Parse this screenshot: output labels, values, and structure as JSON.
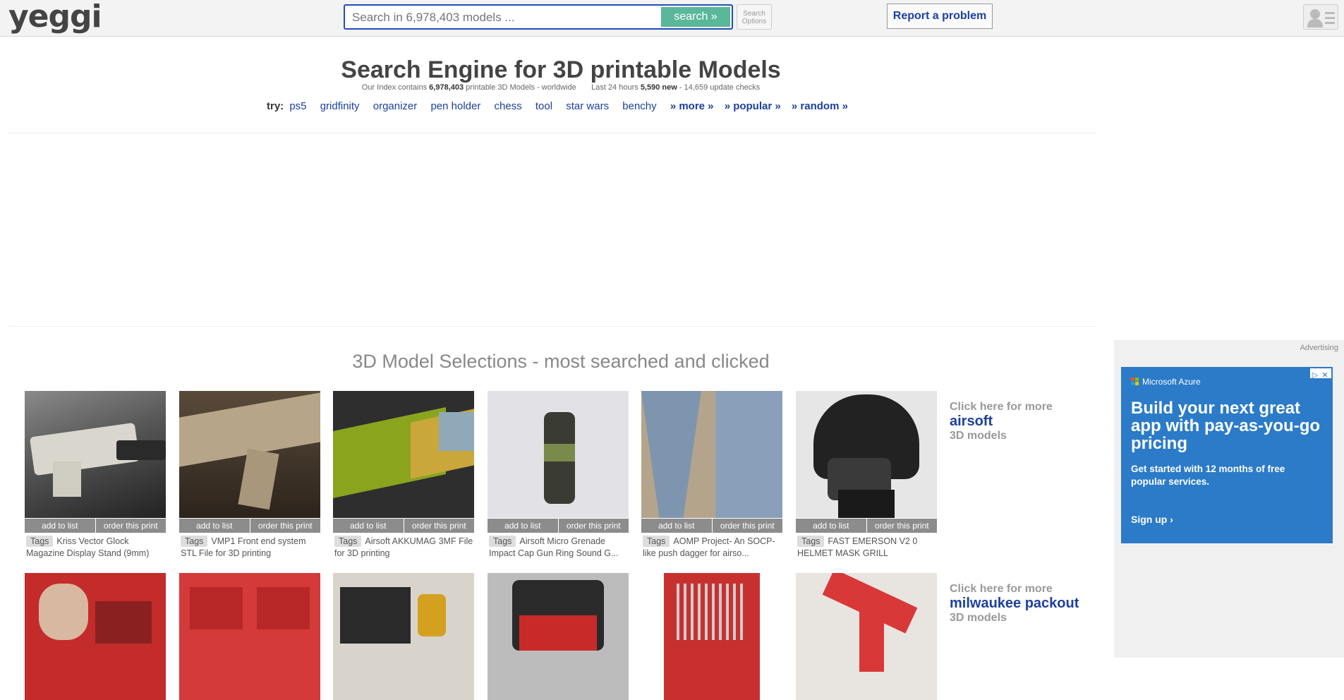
{
  "header": {
    "logo": "yeggi",
    "search_placeholder": "Search in 6,978,403 models ...",
    "search_button": "search »",
    "search_options_line1": "Search",
    "search_options_line2": "Options",
    "report_button": "Report a problem"
  },
  "hero": {
    "title": "Search Engine for 3D printable Models",
    "stats_prefix": "Our Index contains",
    "stats_count": "6,978,403",
    "stats_suffix": "printable 3D Models - worldwide",
    "last24_prefix": "Last 24 hours",
    "last24_new": "5,590 new",
    "last24_suffix": "- 14,659 update checks",
    "try_label": "try:",
    "try_links": [
      "ps5",
      "gridfinity",
      "organizer",
      "pen holder",
      "chess",
      "tool",
      "star wars",
      "benchy"
    ],
    "more_links": [
      "» more »",
      "» popular »",
      "» random »"
    ]
  },
  "selections": {
    "title": "3D Model Selections - most searched and clicked",
    "add_label": "add to list",
    "order_label": "order this print",
    "tag_label": "Tags",
    "row1": [
      {
        "caption": "Kriss Vector Glock Magazine Display Stand (9mm)",
        "image": "gun-photo"
      },
      {
        "caption": "VMP1 Front end system STL File for 3D printing",
        "image": "gun-render"
      },
      {
        "caption": "Airsoft AKKUMAG 3MF File for 3D printing",
        "image": "mag-render"
      },
      {
        "caption": "Airsoft Micro Grenade Impact Cap Gun Ring Sound G...",
        "image": "grenade-photo"
      },
      {
        "caption": "AOMP Project- An SOCP-like push dagger for airso...",
        "image": "dagger-photo"
      },
      {
        "caption": "FAST EMERSON V2 0 HELMET MASK GRILL",
        "image": "helmet-photo"
      }
    ],
    "row1_more": {
      "line1": "Click here for more",
      "line2": "airsoft",
      "line3": "3D models"
    },
    "row2": [
      {
        "image": "red-bins-hand"
      },
      {
        "image": "red-organizer"
      },
      {
        "image": "tool-battery"
      },
      {
        "image": "packout-box"
      },
      {
        "image": "wrench-rack"
      },
      {
        "image": "red-bracket"
      }
    ],
    "row2_more": {
      "line1": "Click here for more",
      "line2": "milwaukee packout",
      "line3": "3D models"
    }
  },
  "ad": {
    "label": "Advertising",
    "brand": "Microsoft Azure",
    "headline": "Build your next great app with pay-as-you-go pricing",
    "sub": "Get started with 12 months of free popular services.",
    "cta": "Sign up ›"
  }
}
